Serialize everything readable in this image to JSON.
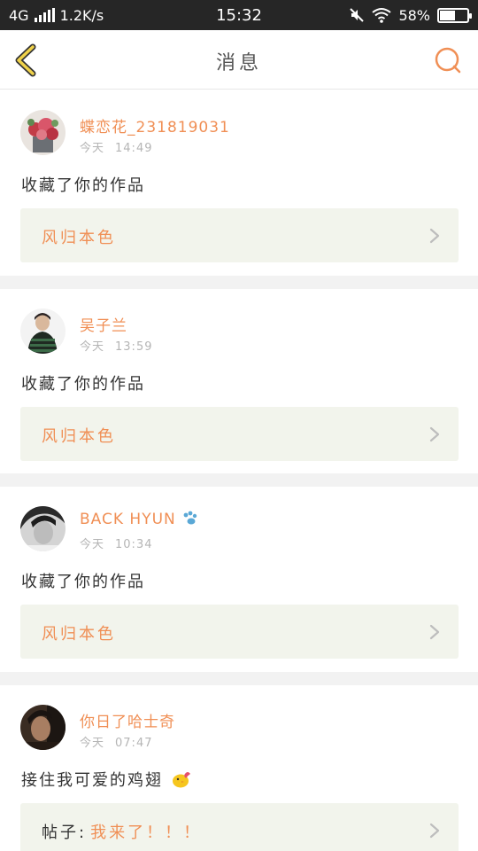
{
  "status_bar": {
    "network": "4G",
    "speed": "1.2K/s",
    "time": "15:32",
    "battery": "58%",
    "battery_level": 0.58
  },
  "nav": {
    "title": "消息",
    "back_icon": "chevron-left-icon",
    "search_icon": "search-icon"
  },
  "colors": {
    "accent": "#f08f55",
    "back_arrow": "#f0d24a",
    "ref_bg": "#f2f4ec"
  },
  "messages": [
    {
      "username": "蝶恋花_231819031",
      "date": "今天",
      "time": "14:49",
      "action": "收藏了你的作品",
      "ref_prefix": "",
      "ref_title": "风归本色"
    },
    {
      "username": "吴子兰",
      "date": "今天",
      "time": "13:59",
      "action": "收藏了你的作品",
      "ref_prefix": "",
      "ref_title": "风归本色"
    },
    {
      "username": "BACK HYUN",
      "date": "今天",
      "time": "10:34",
      "action": "收藏了你的作品",
      "ref_prefix": "",
      "ref_title": "风归本色"
    },
    {
      "username": "你日了哈士奇",
      "date": "今天",
      "time": "07:47",
      "action": "接住我可爱的鸡翅",
      "ref_prefix": "帖子:",
      "ref_title": "我来了！！！"
    }
  ]
}
